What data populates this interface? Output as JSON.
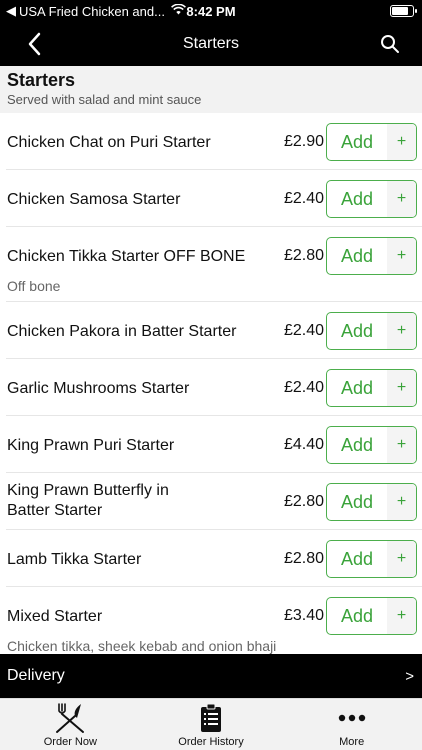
{
  "status_bar": {
    "app_back": "USA Fried Chicken and...",
    "time": "8:42 PM"
  },
  "nav": {
    "title": "Starters"
  },
  "category": {
    "name": "Starters",
    "description": "Served with salad and mint sauce"
  },
  "add_label": "Add",
  "plus_label": "+",
  "items": [
    {
      "name": "Chicken Chat on Puri Starter",
      "price": "£2.90",
      "desc": ""
    },
    {
      "name": "Chicken Samosa Starter",
      "price": "£2.40",
      "desc": ""
    },
    {
      "name": "Chicken Tikka Starter OFF BONE",
      "price": "£2.80",
      "desc": "Off bone"
    },
    {
      "name": "Chicken Pakora in Batter Starter",
      "price": "£2.40",
      "desc": ""
    },
    {
      "name": "Garlic Mushrooms Starter",
      "price": "£2.40",
      "desc": ""
    },
    {
      "name": "King Prawn Puri Starter",
      "price": "£4.40",
      "desc": ""
    },
    {
      "name": "King Prawn Butterfly in Batter Starter",
      "price": "£2.80",
      "desc": ""
    },
    {
      "name": "Lamb Tikka Starter",
      "price": "£2.80",
      "desc": ""
    },
    {
      "name": "Mixed Starter",
      "price": "£3.40",
      "desc": "Chicken tikka, sheek kebab  and onion bhaji"
    }
  ],
  "delivery": {
    "label": "Delivery",
    "arrow": ">"
  },
  "tabs": [
    {
      "label": "Order Now",
      "icon": "fork-knife-icon"
    },
    {
      "label": "Order History",
      "icon": "clipboard-icon"
    },
    {
      "label": "More",
      "icon": "more-dots-icon"
    }
  ],
  "colors": {
    "accent": "#3aa33a",
    "bar": "#000000"
  }
}
